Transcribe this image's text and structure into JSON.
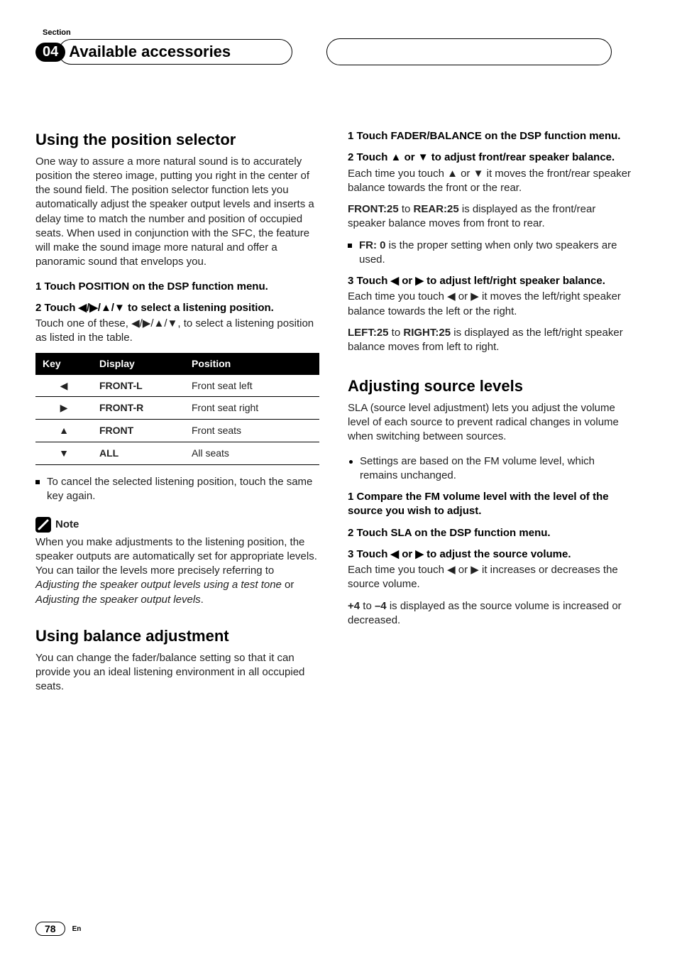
{
  "header": {
    "section_label": "Section",
    "section_number": "04",
    "section_title": "Available accessories"
  },
  "left": {
    "h2a": "Using the position selector",
    "para1": "One way to assure a more natural sound is to accurately position the stereo image, putting you right in the center of the sound field. The position selector function lets you automatically adjust the speaker output levels and inserts a delay time to match the number and position of occupied seats. When used in conjunction with the SFC, the feature will make the sound image more natural and offer a panoramic sound that envelops you.",
    "step1": "1   Touch POSITION on the DSP function menu.",
    "step2": "2   Touch ◀/▶/▲/▼ to select a listening position.",
    "step2_sub": "Touch one of these, ◀/▶/▲/▼, to select a listening position as listed in the table.",
    "table": {
      "headers": {
        "key": "Key",
        "display": "Display",
        "position": "Position"
      },
      "rows": [
        {
          "key": "◀",
          "display": "FRONT-L",
          "position": "Front seat left"
        },
        {
          "key": "▶",
          "display": "FRONT-R",
          "position": "Front seat right"
        },
        {
          "key": "▲",
          "display": "FRONT",
          "position": "Front seats"
        },
        {
          "key": "▼",
          "display": "ALL",
          "position": "All seats"
        }
      ]
    },
    "bullet1": "To cancel the selected listening position, touch the same key again.",
    "note_label": "Note",
    "note_text_a": "When you make adjustments to the listening position, the speaker outputs are automatically set for appropriate levels. You can tailor the levels more precisely referring to ",
    "note_text_b": "Adjusting the speaker output levels using a test tone",
    "note_text_c": " or ",
    "note_text_d": "Adjusting the speaker output levels",
    "note_text_e": ".",
    "h2b": "Using balance adjustment",
    "para2": "You can change the fader/balance setting so that it can provide you an ideal listening environment in all occupied seats."
  },
  "right": {
    "step1": "1   Touch FADER/BALANCE on the DSP function menu.",
    "step2": "2   Touch ▲ or ▼ to adjust front/rear speaker balance.",
    "step2_sub": "Each time you touch ▲ or ▼ it moves the front/rear speaker balance towards the front or the rear.",
    "frontrear_a": "FRONT:25",
    "frontrear_mid": " to ",
    "frontrear_b": "REAR:25",
    "frontrear_tail": " is displayed as the front/rear speaker balance moves from front to rear.",
    "fr0_a": "FR: 0",
    "fr0_b": " is the proper setting when only two speakers are used.",
    "step3": "3   Touch ◀ or ▶ to adjust left/right speaker balance.",
    "step3_sub": "Each time you touch ◀ or ▶ it moves the left/right speaker balance towards the left or the right.",
    "leftright_a": "LEFT:25",
    "leftright_mid": " to ",
    "leftright_b": "RIGHT:25",
    "leftright_tail": " is displayed as the left/right speaker balance moves from left to right.",
    "h2c": "Adjusting source levels",
    "para3": "SLA (source level adjustment) lets you adjust the volume level of each source to prevent radical changes in volume when switching between sources.",
    "bullet2": "Settings are based on the FM volume level, which remains unchanged.",
    "stepc1": "1   Compare the FM volume level with the level of the source you wish to adjust.",
    "stepc2": "2   Touch SLA on the DSP function menu.",
    "stepc3": "3   Touch ◀ or ▶ to adjust the source volume.",
    "stepc3_sub": "Each time you touch ◀ or ▶ it increases or decreases the source volume.",
    "range_a": "+4",
    "range_mid": " to ",
    "range_b": "–4",
    "range_tail": " is displayed as the source volume is increased or decreased."
  },
  "footer": {
    "page": "78",
    "lang": "En"
  }
}
